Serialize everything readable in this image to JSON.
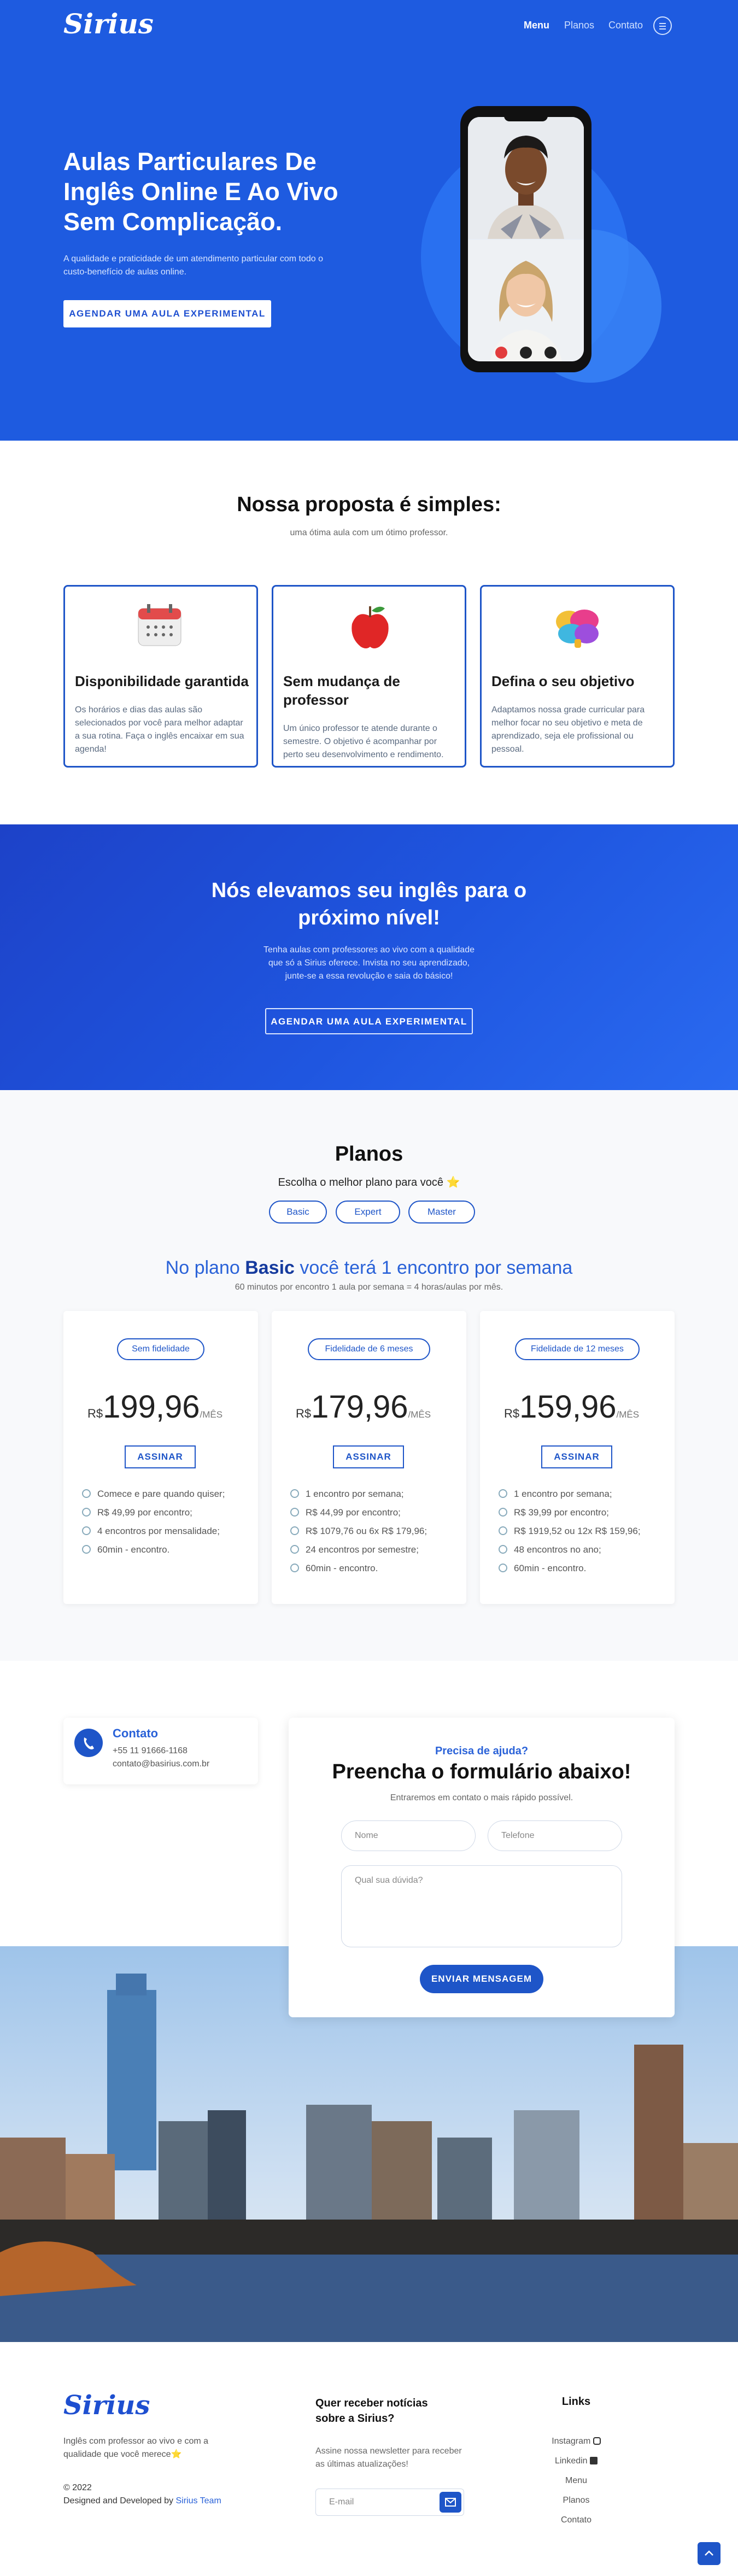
{
  "nav": {
    "logo": "Sirius",
    "items": [
      "Menu",
      "Planos",
      "Contato"
    ]
  },
  "hero": {
    "title_lines": [
      "Aulas Particulares De",
      "Inglês Online E Ao Vivo",
      "Sem Complicação."
    ],
    "desc_lines": [
      "A qualidade e praticidade de um atendimento particular com todo o",
      "custo-benefício de aulas online."
    ],
    "cta": "AGENDAR UMA AULA EXPERIMENTAL"
  },
  "proposal": {
    "title": "Nossa proposta é simples:",
    "subtitle": "uma ótima aula com um ótimo professor.",
    "cards": [
      {
        "icon": "calendar-icon",
        "title": "Disponibilidade garantida",
        "text": "Os horários e dias das aulas são selecionados por você para melhor adaptar a sua rotina. Faça o inglês encaixar em sua agenda!"
      },
      {
        "icon": "apple-icon",
        "title": "Sem mudança de professor",
        "text": "Um único professor te atende durante o semestre. O objetivo é acompanhar por perto seu desenvolvimento e rendimento."
      },
      {
        "icon": "brain-icon",
        "title": "Defina o seu objetivo",
        "text": "Adaptamos nossa grade curricular para melhor focar no seu objetivo e meta de aprendizado, seja ele profissional ou pessoal."
      }
    ]
  },
  "level": {
    "title_lines": [
      "Nós elevamos seu inglês para o",
      "próximo nível!"
    ],
    "text_lines": [
      "Tenha aulas com professores ao vivo com a qualidade",
      "que só a Sirius oferece. Invista no seu aprendizado,",
      "junte-se a essa revolução e saia do básico!"
    ],
    "cta": "AGENDAR UMA AULA EXPERIMENTAL"
  },
  "plans": {
    "title": "Planos",
    "subtitle": "Escolha o melhor plano para você ⭐",
    "tabs": [
      "Basic",
      "Expert",
      "Master"
    ],
    "headline_pre": "No plano ",
    "headline_bold": "Basic",
    "headline_post": " você terá 1 encontro por semana",
    "note": "60 minutos por encontro 1 aula por semana = 4 horas/aulas por mês.",
    "currency": "R$",
    "period": "/MÊS",
    "buy": "ASSINAR",
    "cards": [
      {
        "badge": "Sem fidelidade",
        "price": "199,96",
        "features": [
          "Comece e pare quando quiser;",
          "R$ 49,99 por encontro;",
          "4 encontros por mensalidade;",
          "60min - encontro."
        ]
      },
      {
        "badge": "Fidelidade de 6 meses",
        "price": "179,96",
        "features": [
          "1 encontro por semana;",
          "R$ 44,99 por encontro;",
          "R$ 1079,76 ou 6x R$ 179,96;",
          "24 encontros por semestre;",
          "60min - encontro."
        ]
      },
      {
        "badge": "Fidelidade de 12 meses",
        "price": "159,96",
        "features": [
          "1 encontro por semana;",
          "R$ 39,99 por encontro;",
          "R$ 1919,52 ou 12x R$ 159,96;",
          "48 encontros no ano;",
          "60min - encontro."
        ]
      }
    ]
  },
  "contact": {
    "title": "Contato",
    "phone": "+55 11 91666-1168",
    "email": "contato@basirius.com.br",
    "form_kicker": "Precisa de ajuda?",
    "form_title": "Preencha o formulário abaixo!",
    "form_sub": "Entraremos em contato o mais rápido possível.",
    "name_ph": "Nome",
    "phone_ph": "Telefone",
    "msg_ph": "Qual sua dúvida?",
    "send": "ENVIAR MENSAGEM"
  },
  "footer": {
    "logo": "Sirius",
    "tagline_lines": [
      "Inglês com professor ao vivo e com a",
      "qualidade que você merece⭐"
    ],
    "year": "© 2022",
    "credit_pre": "Designed and Developed by ",
    "credit_link": "Sirius Team",
    "news_title_lines": [
      "Quer receber notícias",
      "sobre a Sirius?"
    ],
    "news_text_lines": [
      "Assine nossa newsletter para receber",
      "as últimas atualizações!"
    ],
    "email_ph": "E-mail",
    "links_title": "Links",
    "links": [
      "Instagram",
      "Linkedin",
      "Menu",
      "Planos",
      "Contato"
    ]
  },
  "colors": {
    "primary": "#1e5be0",
    "dark": "#1e55c8",
    "accent_text": "#2a62d8"
  }
}
